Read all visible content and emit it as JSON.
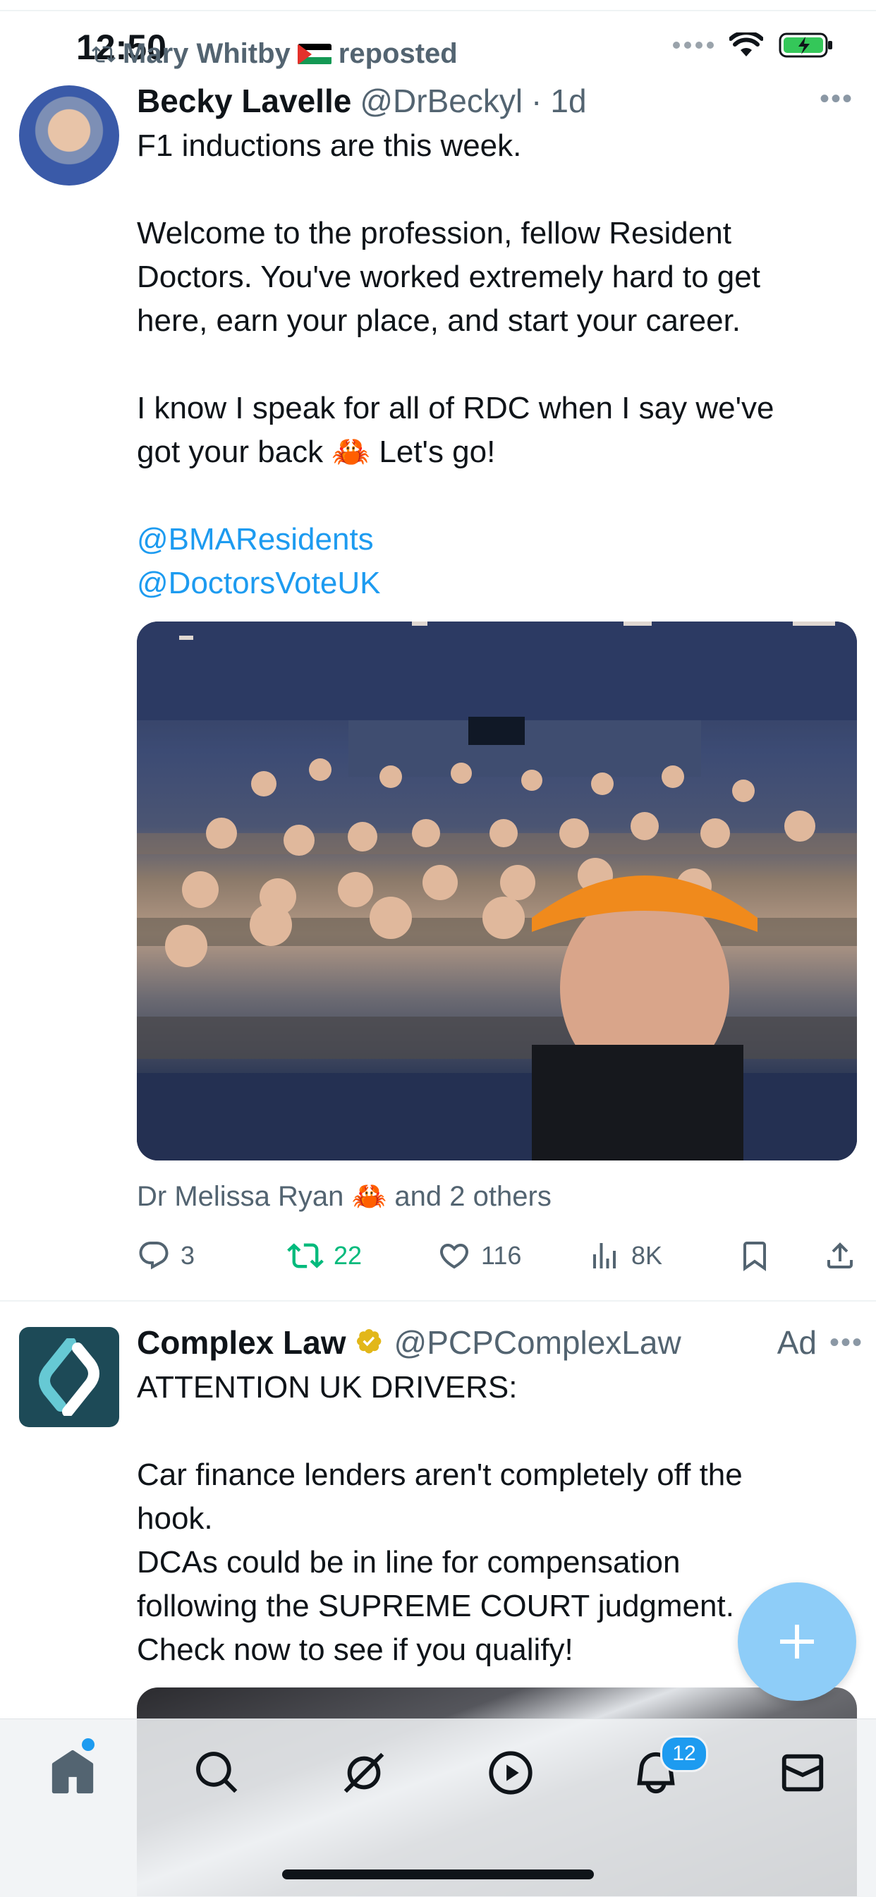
{
  "status_bar": {
    "time": "12:50"
  },
  "repost": {
    "user": "Mary Whitby",
    "suffix": "reposted"
  },
  "tweet1": {
    "name": "Becky Lavelle",
    "handle": "@DrBeckyl",
    "dot": "·",
    "age": "1d",
    "lines": [
      "F1 inductions are this week.",
      "Welcome to the profession, fellow Resident",
      "Doctors. You've worked extremely hard to get",
      "here, earn your place, and start your career.",
      "I know I speak for all of RDC when I say we've",
      "got your back 🦀 Let's go!"
    ],
    "mentions": [
      "@BMAResidents",
      "@DoctorsVoteUK"
    ],
    "liked_by": "Dr Melissa Ryan 🦀 and 2 others",
    "replies": "3",
    "reposts": "22",
    "likes": "116",
    "views": "8K"
  },
  "tweet2": {
    "name": "Complex Law",
    "handle": "@PCPComplexLaw",
    "ad_label": "Ad",
    "lines": [
      "ATTENTION UK DRIVERS:",
      "Car finance lenders aren't completely off the",
      "hook.",
      "DCAs could be in line for compensation",
      "following the SUPREME COURT judgment.",
      "Check now to see if you qualify!"
    ]
  },
  "tabbar": {
    "notifications_badge": "12"
  },
  "colors": {
    "accent": "#1d9bf0",
    "repost_green": "#00ba7c",
    "secondary_text": "#536471"
  },
  "icons": [
    "reply-icon",
    "repost-icon",
    "like-icon",
    "views-icon",
    "bookmark-icon",
    "share-icon",
    "home-icon",
    "search-icon",
    "grok-icon",
    "video-icon",
    "notifications-icon",
    "messages-icon",
    "compose-icon",
    "verified-badge-icon",
    "more-icon"
  ]
}
